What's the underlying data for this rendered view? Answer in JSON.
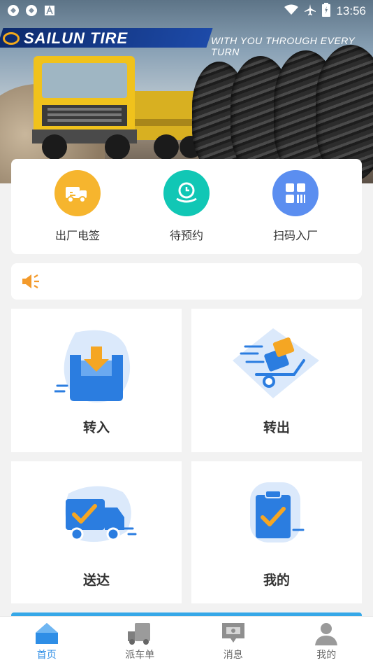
{
  "status_bar": {
    "time": "13:56",
    "left_icons": [
      "app-notification-icon",
      "app-notification-icon",
      "text-notification-icon"
    ],
    "right_icons": [
      "wifi-icon",
      "airplane-icon",
      "battery-icon"
    ]
  },
  "banner": {
    "brand": "SAILUN TIRE",
    "slogan": "WITH YOU THROUGH EVERY TURN"
  },
  "quick_actions": [
    {
      "label": "出厂电签",
      "icon": "truck-sign-icon",
      "color": "#f6b52e"
    },
    {
      "label": "待预约",
      "icon": "clock-hand-icon",
      "color": "#11c7b5"
    },
    {
      "label": "扫码入厂",
      "icon": "qr-scan-icon",
      "color": "#5b8ef0"
    }
  ],
  "notice": {
    "icon": "speaker-icon",
    "text": ""
  },
  "tiles": [
    {
      "label": "转入",
      "icon": "inbox-download-icon"
    },
    {
      "label": "转出",
      "icon": "hand-cart-icon"
    },
    {
      "label": "送达",
      "icon": "delivery-truck-icon"
    },
    {
      "label": "我的",
      "icon": "clipboard-check-icon"
    }
  ],
  "bottom_nav": {
    "active_index": 0,
    "items": [
      {
        "label": "首页",
        "icon": "home-icon"
      },
      {
        "label": "派车单",
        "icon": "truck-icon"
      },
      {
        "label": "消息",
        "icon": "message-icon"
      },
      {
        "label": "我的",
        "icon": "user-icon"
      }
    ]
  },
  "colors": {
    "accent": "#2e8ee6",
    "tile_blue": "#2b7de0",
    "check_orange": "#f5a623"
  }
}
